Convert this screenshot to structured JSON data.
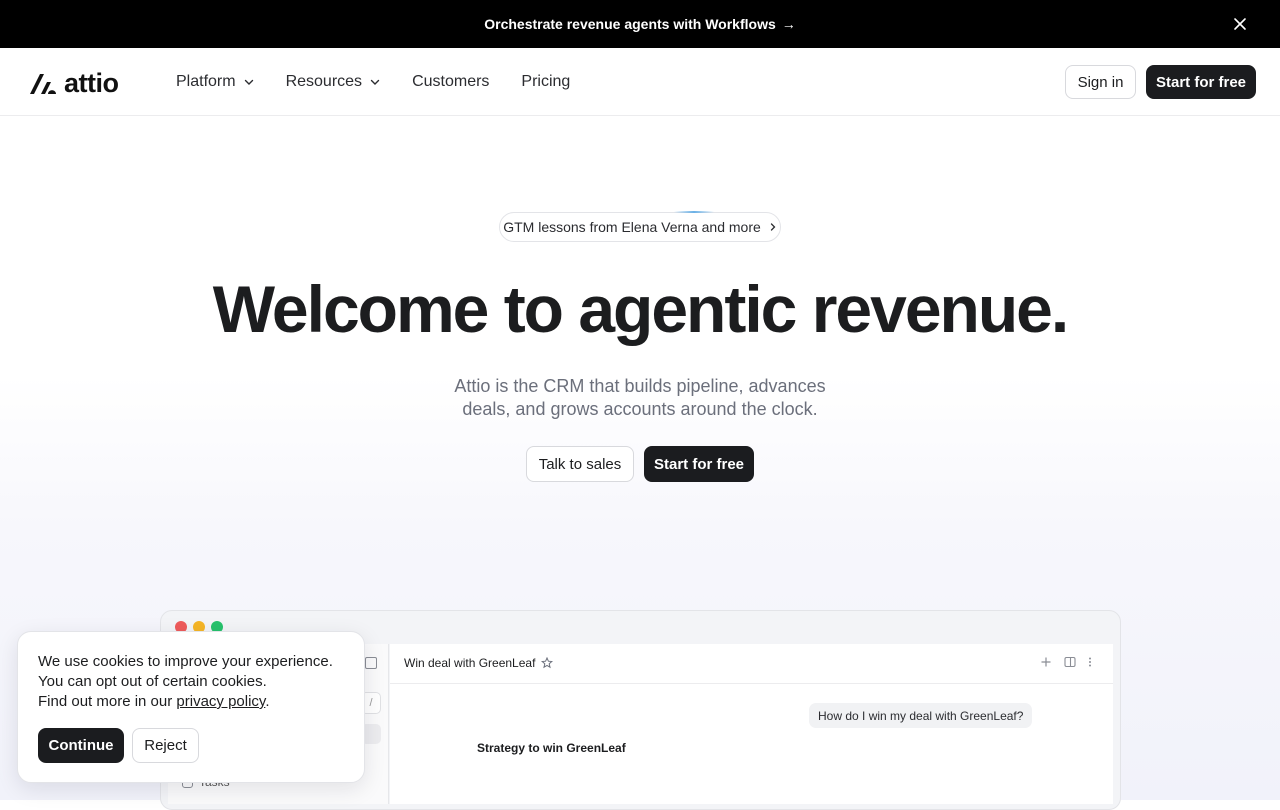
{
  "announcement": {
    "text": "Orchestrate revenue agents with Workflows",
    "arrow": "→"
  },
  "nav": {
    "logo_text": "attio",
    "items": [
      {
        "label": "Platform",
        "has_dropdown": true
      },
      {
        "label": "Resources",
        "has_dropdown": true
      },
      {
        "label": "Customers",
        "has_dropdown": false
      },
      {
        "label": "Pricing",
        "has_dropdown": false
      }
    ],
    "sign_in": "Sign in",
    "start_free": "Start for free"
  },
  "hero": {
    "pill_text": "GTM lessons from Elena Verna and more",
    "headline": "Welcome to agentic revenue.",
    "subtitle": "Attio is the CRM that builds pipeline, advances deals, and grows accounts around the clock.",
    "talk_to_sales": "Talk to sales",
    "start_free": "Start for free"
  },
  "app_preview": {
    "window_dot_colors": [
      "#ee5b5b",
      "#f5b526",
      "#27c26c"
    ],
    "slash_hint": "/",
    "task_label": "Tasks",
    "record_title": "Win deal with GreenLeaf",
    "chat_question": "How do I win my deal with GreenLeaf?",
    "chat_answer_heading": "Strategy to win GreenLeaf"
  },
  "cookie_banner": {
    "line1": "We use cookies to improve your experience.",
    "line2": "You can opt out of certain cookies.",
    "line3_prefix": "Find out more in our ",
    "link": "privacy policy",
    "line3_suffix": ".",
    "continue": "Continue",
    "reject": "Reject"
  },
  "colors": {
    "announcement_bg": "#000000",
    "primary_button": "#1b1c1f",
    "subtitle": "#6b6f7b"
  }
}
